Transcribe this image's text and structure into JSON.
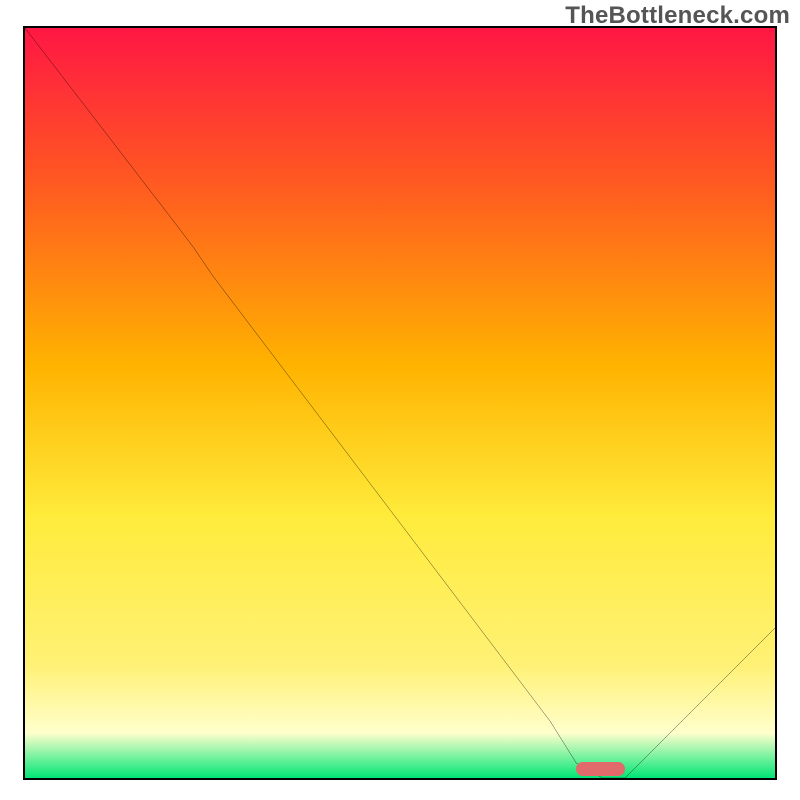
{
  "watermark": "TheBottleneck.com",
  "chart_data": {
    "type": "line",
    "x": [
      0.0,
      0.05,
      0.1,
      0.15,
      0.2,
      0.225,
      0.25,
      0.3,
      0.35,
      0.4,
      0.45,
      0.5,
      0.55,
      0.6,
      0.65,
      0.7,
      0.735,
      0.77,
      0.8,
      0.85,
      0.9,
      0.95,
      1.0
    ],
    "values": [
      1.0,
      0.935,
      0.87,
      0.805,
      0.74,
      0.707,
      0.67,
      0.604,
      0.538,
      0.472,
      0.406,
      0.34,
      0.274,
      0.208,
      0.142,
      0.076,
      0.02,
      0.0,
      0.0,
      0.05,
      0.1,
      0.15,
      0.2
    ],
    "ylim": [
      0,
      1
    ],
    "xlabel": "",
    "ylabel": "",
    "title": "",
    "gradient_stops": [
      {
        "offset": 0.0,
        "color": "#ff1744"
      },
      {
        "offset": 0.2,
        "color": "#ff5722"
      },
      {
        "offset": 0.45,
        "color": "#ffb300"
      },
      {
        "offset": 0.65,
        "color": "#ffeb3b"
      },
      {
        "offset": 0.85,
        "color": "#fff176"
      },
      {
        "offset": 0.94,
        "color": "#ffffcc"
      },
      {
        "offset": 1.0,
        "color": "#00e676"
      }
    ],
    "marker": {
      "x_start": 0.735,
      "x_end": 0.8,
      "y": 0.0,
      "color": "#e16a6a"
    }
  }
}
